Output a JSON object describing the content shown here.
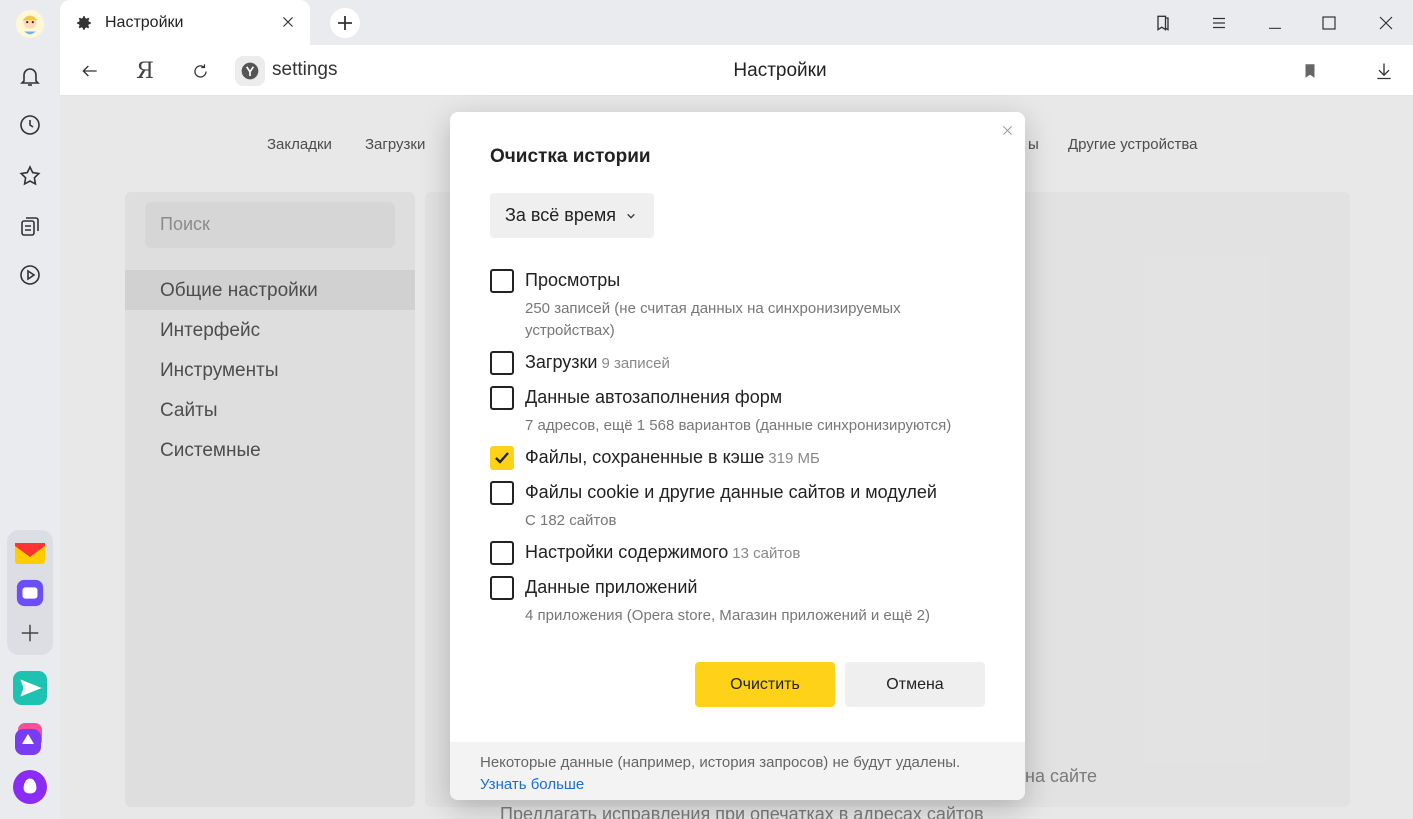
{
  "tab": {
    "title": "Настройки"
  },
  "addressbar": {
    "url": "settings",
    "page_title": "Настройки",
    "logo": "Я"
  },
  "settings": {
    "topnav": [
      "Закладки",
      "Загрузки",
      "ы",
      "Другие устройства"
    ],
    "search_placeholder": "Поиск",
    "menu": [
      "Общие настройки",
      "Интерфейс",
      "Инструменты",
      "Сайты",
      "Системные"
    ],
    "bg_text_right": "на сайте",
    "bg_text_bottom": "Предлагать исправления при опечатках в адресах сайтов"
  },
  "dialog": {
    "title": "Очистка истории",
    "period": "За всё время",
    "options": [
      {
        "label": "Просмотры",
        "count": "",
        "desc": "250 записей (не считая данных на синхронизируемых устройствах)",
        "checked": false
      },
      {
        "label": "Загрузки",
        "count": "9 записей",
        "desc": "",
        "checked": false
      },
      {
        "label": "Данные автозаполнения форм",
        "count": "",
        "desc": "7 адресов, ещё 1 568 вариантов (данные синхронизируются)",
        "checked": false
      },
      {
        "label": "Файлы, сохраненные в кэше",
        "count": "319 МБ",
        "desc": "",
        "checked": true
      },
      {
        "label": "Файлы cookie и другие данные сайтов и модулей",
        "count": "",
        "desc": "С 182 сайтов",
        "checked": false
      },
      {
        "label": "Настройки содержимого",
        "count": "13 сайтов",
        "desc": "",
        "checked": false
      },
      {
        "label": "Данные приложений",
        "count": "",
        "desc": "4 приложения (Opera store, Магазин приложений и ещё 2)",
        "checked": false
      }
    ],
    "clear_button": "Очистить",
    "cancel_button": "Отмена",
    "footer_note": "Некоторые данные (например, история запросов) не будут удалены.",
    "footer_link": "Узнать больше"
  },
  "colors": {
    "accent": "#ffd21a",
    "link": "#1a6fcf"
  },
  "icons": {
    "sidebar": [
      "avatar",
      "bell-icon",
      "history-icon",
      "star-icon",
      "collections-icon",
      "play-icon"
    ],
    "apps": [
      "mail-icon",
      "messenger-icon",
      "add-icon",
      "send-icon",
      "alice-app-icon",
      "alice-icon"
    ],
    "window": [
      "bookmarks-panel-icon",
      "menu-icon",
      "minimize-icon",
      "maximize-icon",
      "close-icon"
    ]
  }
}
